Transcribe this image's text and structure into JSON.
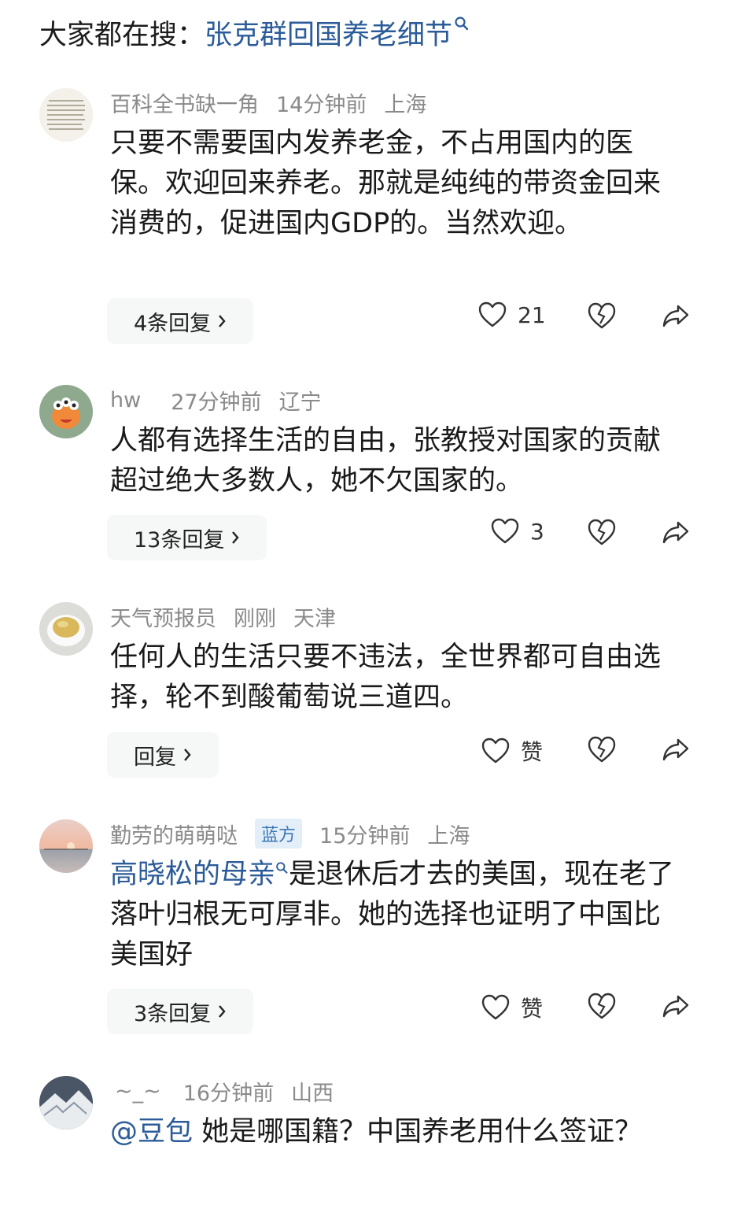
{
  "search": {
    "prefix": "大家都在搜：",
    "term": "张克群回国养老细节"
  },
  "comments": [
    {
      "username": "百科全书缺一角",
      "time": "14分钟前",
      "location": "上海",
      "text": "只要不需要国内发养老金，不占用国内的医保。欢迎回来养老。那就是纯纯的带资金回来消费的，促进国内GDP的。当然欢迎。",
      "replies": "4条回复",
      "likes": "21"
    },
    {
      "username": "hw",
      "time": "27分钟前",
      "location": "辽宁",
      "text": "人都有选择生活的自由，张教授对国家的贡献超过绝大多数人，她不欠国家的。",
      "replies": "13条回复",
      "likes": "3"
    },
    {
      "username": "天气预报员",
      "time": "刚刚",
      "location": "天津",
      "text": "任何人的生活只要不违法，全世界都可自由选择，轮不到酸葡萄说三道四。",
      "replies": "回复",
      "likes": "赞"
    },
    {
      "username": "勤劳的萌萌哒",
      "badge": "蓝方",
      "time": "15分钟前",
      "location": "上海",
      "link": "高晓松的母亲",
      "text": "是退休后才去的美国，现在老了落叶归根无可厚非。她的选择也证明了中国比美国好",
      "replies": "3条回复",
      "likes": "赞"
    },
    {
      "username": "~_~",
      "time": "16分钟前",
      "location": "山西",
      "mention": "@豆包",
      "text": "她是哪国籍？中国养老用什么签证？"
    }
  ],
  "colors": {
    "link": "#2b5c99",
    "meta": "#8a8a8a",
    "badge_bg": "#e3eef9",
    "badge_text": "#3c78b5",
    "pill_bg": "#f6f7f7"
  }
}
